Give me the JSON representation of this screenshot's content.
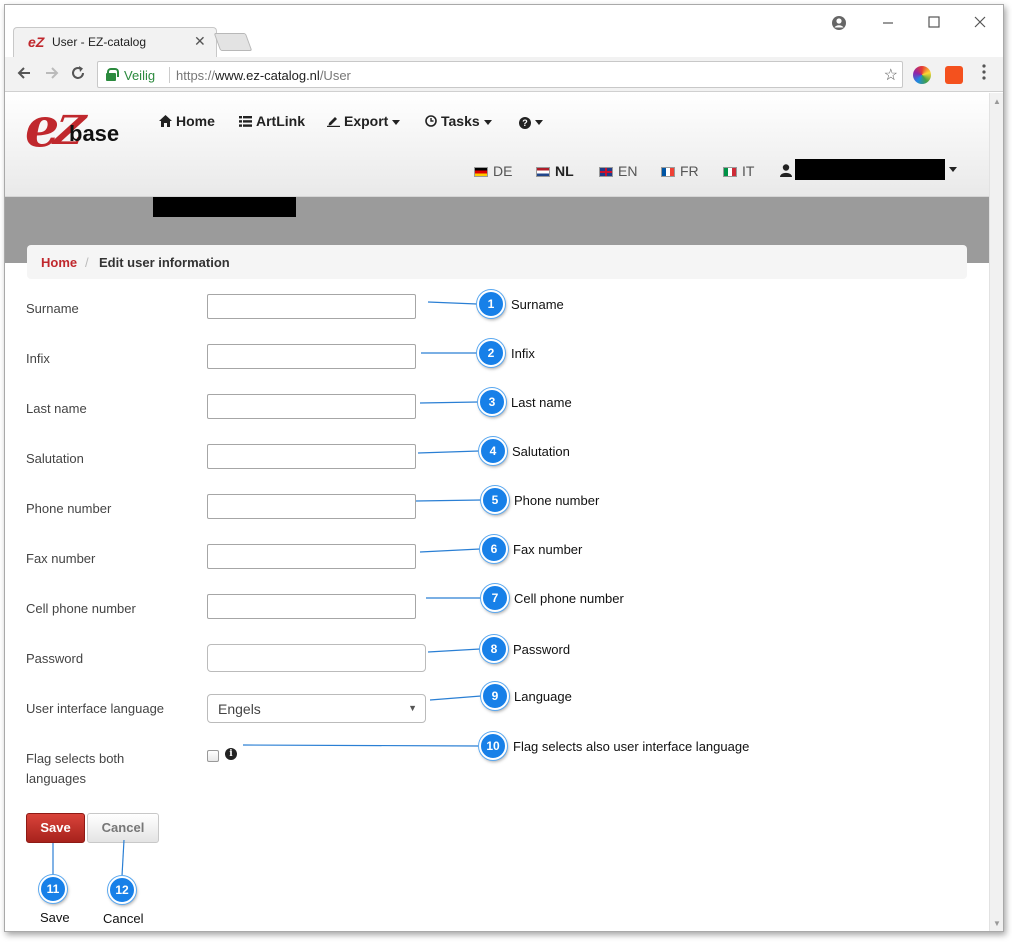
{
  "browser": {
    "tab_title": "User - EZ-catalog",
    "tab_close": "✕",
    "secure_label": "Veilig",
    "url_scheme": "https://",
    "url_host": "www.ez-catalog.nl",
    "url_path": "/User"
  },
  "site": {
    "logo_e": "e",
    "logo_z": "Z",
    "logo_text": "base",
    "nav": [
      {
        "label": "Home",
        "icon": "home-icon"
      },
      {
        "label": "ArtLink",
        "icon": "list-icon"
      },
      {
        "label": "Export",
        "icon": "export-icon"
      },
      {
        "label": "Tasks",
        "icon": "clock-icon"
      },
      {
        "label": "",
        "icon": "help-icon"
      }
    ],
    "languages": [
      {
        "code": "DE",
        "active": false
      },
      {
        "code": "NL",
        "active": true
      },
      {
        "code": "EN",
        "active": false
      },
      {
        "code": "FR",
        "active": false
      },
      {
        "code": "IT",
        "active": false
      }
    ]
  },
  "breadcrumb": {
    "home": "Home",
    "separator": "/",
    "current": "Edit user information"
  },
  "form": {
    "fields": [
      {
        "label": "Surname",
        "value": ""
      },
      {
        "label": "Infix",
        "value": ""
      },
      {
        "label": "Last name",
        "value": ""
      },
      {
        "label": "Salutation",
        "value": ""
      },
      {
        "label": "Phone number",
        "value": ""
      },
      {
        "label": "Fax number",
        "value": ""
      },
      {
        "label": "Cell phone number",
        "value": ""
      },
      {
        "label": "Password",
        "value": ""
      }
    ],
    "language_label": "User interface language",
    "language_value": "Engels",
    "flag_label_line1": "Flag selects both",
    "flag_label_line2": "languages",
    "flag_checked": false,
    "save_label": "Save",
    "cancel_label": "Cancel"
  },
  "callouts": [
    {
      "number": "1",
      "text": "Surname"
    },
    {
      "number": "2",
      "text": "Infix"
    },
    {
      "number": "3",
      "text": "Last name"
    },
    {
      "number": "4",
      "text": "Salutation"
    },
    {
      "number": "5",
      "text": "Phone number"
    },
    {
      "number": "6",
      "text": "Fax number"
    },
    {
      "number": "7",
      "text": "Cell phone number"
    },
    {
      "number": "8",
      "text": "Password"
    },
    {
      "number": "9",
      "text": "Language"
    },
    {
      "number": "10",
      "text": "Flag selects also user interface language"
    },
    {
      "number": "11",
      "text": "Save"
    },
    {
      "number": "12",
      "text": "Cancel"
    }
  ],
  "colors": {
    "brand_red": "#c0282d",
    "callout_blue": "#1780e8",
    "secure_green": "#2b8a3e"
  }
}
